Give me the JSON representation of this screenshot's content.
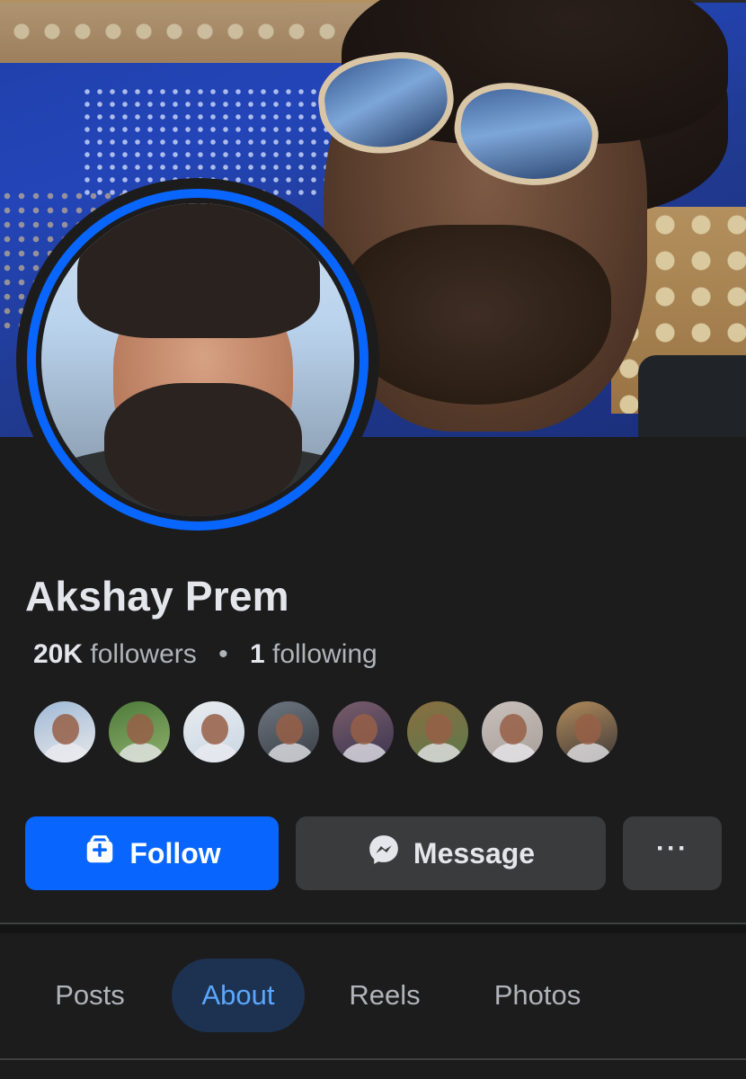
{
  "profile": {
    "name": "Akshay Prem",
    "followers_count": "20K",
    "followers_label": "followers",
    "separator": "•",
    "following_count": "1",
    "following_label": "following"
  },
  "friends": {
    "avatar_count": 8
  },
  "actions": {
    "follow_label": "Follow",
    "message_label": "Message",
    "more_label": "···"
  },
  "tabs": [
    {
      "label": "Posts",
      "selected": false
    },
    {
      "label": "About",
      "selected": true
    },
    {
      "label": "Reels",
      "selected": false
    },
    {
      "label": "Photos",
      "selected": false
    }
  ],
  "colors": {
    "background": "#1c1c1d",
    "accent": "#0866ff",
    "button_secondary": "#3a3b3c",
    "tab_selected_bg": "#1d3251",
    "tab_selected_text": "#5aa7ff",
    "text_primary": "#e4e6eb",
    "text_secondary": "#b0b3b8"
  },
  "icons": {
    "follow": "follow-add-icon",
    "message": "messenger-icon",
    "more": "more-dots-icon"
  }
}
